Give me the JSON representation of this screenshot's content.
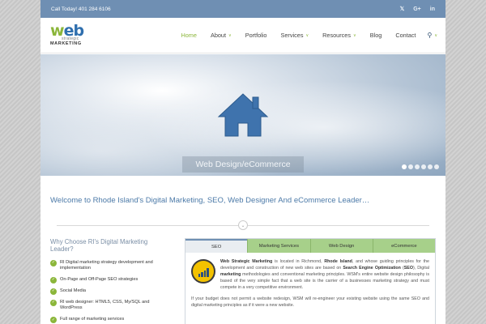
{
  "topbar": {
    "phone": "Call Today! 401 284 6106",
    "social": [
      {
        "icon": "twitter-icon",
        "glyph": "🐦︎"
      },
      {
        "icon": "google-plus-icon",
        "glyph": "G+"
      },
      {
        "icon": "linkedin-icon",
        "glyph": "in"
      }
    ]
  },
  "logo": {
    "web_w": "w",
    "web_rest": "eb",
    "line2": "strategic",
    "line3": "MARKETING"
  },
  "nav": {
    "items": [
      {
        "label": "Home",
        "active": true,
        "dropdown": false
      },
      {
        "label": "About",
        "active": false,
        "dropdown": true
      },
      {
        "label": "Portfolio",
        "active": false,
        "dropdown": false
      },
      {
        "label": "Services",
        "active": false,
        "dropdown": true
      },
      {
        "label": "Resources",
        "active": false,
        "dropdown": true
      },
      {
        "label": "Blog",
        "active": false,
        "dropdown": false
      },
      {
        "label": "Contact",
        "active": false,
        "dropdown": false
      }
    ]
  },
  "hero": {
    "caption": "Web Design/eCommerce",
    "slides": 6,
    "current_slide": 1
  },
  "welcome": "Welcome to Rhode Island's Digital Marketing, SEO, Web  Designer And eCommerce Leader…",
  "why": {
    "title": "Why Choose RI's Digital Marketing Leader?",
    "items": [
      "RI Digital marketing strategy development and implementation",
      "On-Page and Off-Page SEO strategies",
      "Social Media",
      "RI web designer: HTML5, CSS, My/SQL and WordPress",
      "Full range of marketing services"
    ]
  },
  "tabs": [
    "SEO",
    "Marketing Services",
    "Web Design",
    "eCommerce"
  ],
  "panel": {
    "p1": [
      {
        "t": "Web Strategic Marketing",
        "b": true
      },
      {
        "t": " is located in Richmond, ",
        "b": false
      },
      {
        "t": "Rhode Island",
        "b": true
      },
      {
        "t": ", and whose guiding principles for the development and construction of new web sites are based on ",
        "b": false
      },
      {
        "t": "Search Engine Optimization",
        "b": true
      },
      {
        "t": " (",
        "b": false
      },
      {
        "t": "SEO",
        "b": true
      },
      {
        "t": "), Digital ",
        "b": false
      },
      {
        "t": "marketing",
        "b": true
      },
      {
        "t": " methodologies and conventional marketing principles. WSM's entire website design philosophy is based of the very simple fact that a web site is the carrier of a businesses marketing strategy and must compete in a very competitive environment.",
        "b": false
      }
    ],
    "p2": "If your budget does not permit a website redesign, WSM will re-engineer your existing website using the same SEO and digital marketing principles as if it were a new website."
  },
  "colors": {
    "accent_green": "#8bb63a",
    "topbar_blue": "#6f8fb3",
    "title_blue": "#4c7aa8"
  }
}
